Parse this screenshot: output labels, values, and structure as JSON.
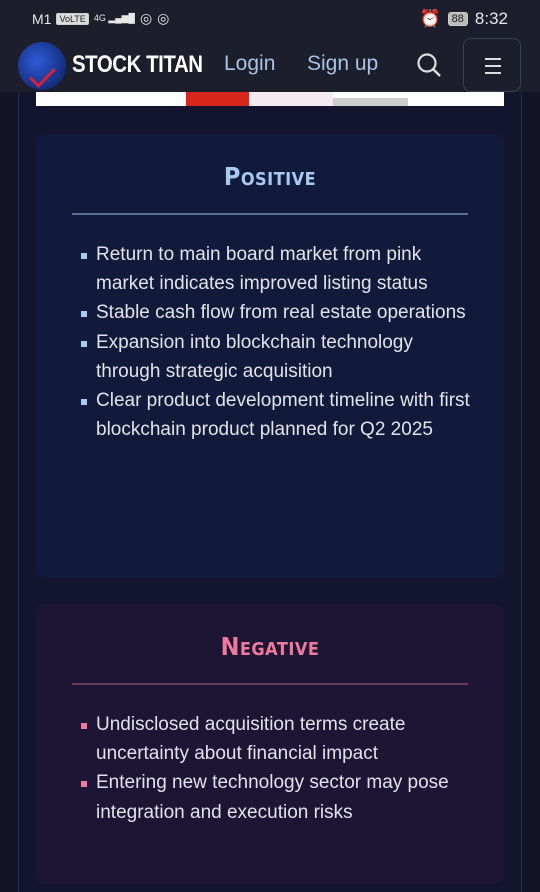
{
  "status_bar": {
    "carrier": "M1",
    "volte": "VoLTE",
    "network": "4G",
    "battery": "88",
    "time": "8:32"
  },
  "header": {
    "brand": "STOCK TITAN",
    "login": "Login",
    "signup": "Sign up"
  },
  "positive": {
    "title": "Positive",
    "color": "#a8caf0",
    "items": [
      "Return to main board market from pink market indicates improved listing status",
      "Stable cash flow from real estate operations",
      "Expansion into blockchain technology through strategic acquisition",
      "Clear product development timeline with first blockchain product planned for Q2 2025"
    ]
  },
  "negative": {
    "title": "Negative",
    "color": "#f07a9e",
    "items": [
      "Undisclosed acquisition terms create uncertainty about financial impact",
      "Entering new technology sector may pose integration and execution risks"
    ]
  }
}
